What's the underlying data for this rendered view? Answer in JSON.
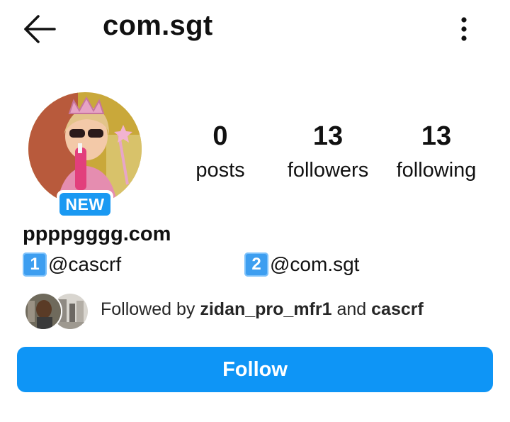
{
  "header": {
    "title": "com.sgt",
    "back_icon": "arrow-left-icon",
    "more_icon": "more-vertical-icon"
  },
  "profile": {
    "badge": "NEW",
    "stats": [
      {
        "value": "0",
        "label": "posts"
      },
      {
        "value": "13",
        "label": "followers"
      },
      {
        "value": "13",
        "label": "following"
      }
    ],
    "full_name": "ppppgggg.com",
    "bio": [
      {
        "key": "1",
        "handle": "@cascrf"
      },
      {
        "key": "2",
        "handle": "@com.sgt"
      }
    ],
    "followed_by": {
      "prefix": "Followed by ",
      "user1": "zidan_pro_mfr1",
      "joiner": " and ",
      "user2": "cascrf"
    }
  },
  "actions": {
    "follow_label": "Follow"
  },
  "colors": {
    "accent": "#0e95f6",
    "badge": "#1a99f2",
    "keycap": "#3d9ef0"
  }
}
